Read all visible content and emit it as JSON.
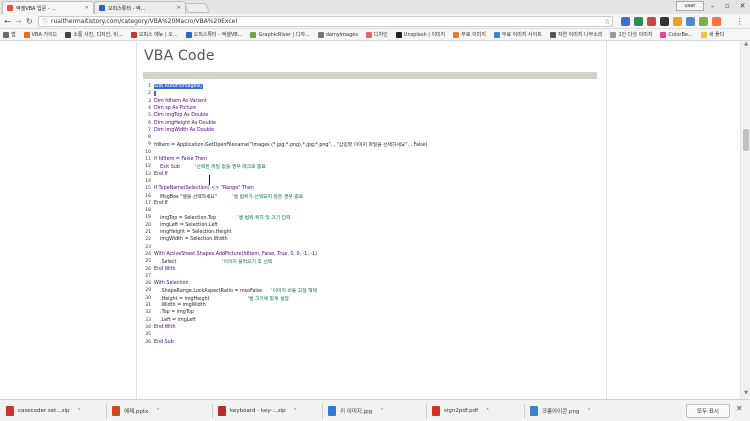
{
  "tabs": [
    {
      "title": "엑셀VBA 입문 - ...",
      "color": "#e8523a",
      "active": true
    },
    {
      "title": "오피스튜터 - 엑...",
      "color": "#2a64c8",
      "active": false
    }
  ],
  "window": {
    "user": "user"
  },
  "toolbar": {
    "url": "rualthermaitistory.com/category/VBA%20Macro/VBA%20Excel",
    "extensions": [
      "#3a6fd8",
      "#2c8f4e",
      "#d04242",
      "#333333",
      "#f0a020",
      "#4f8ad8"
    ]
  },
  "bookmarks": [
    {
      "label": "앱",
      "color": "#6a6a6a"
    },
    {
      "label": "VBA 가이드",
      "color": "#e07020"
    },
    {
      "label": "소통 사진, 디자인, 비...",
      "color": "#444"
    },
    {
      "label": "오피스 메뉴 | 오...",
      "color": "#c43a2a"
    },
    {
      "label": "오피스튜터 - 엑셀VB...",
      "color": "#2a64c8"
    },
    {
      "label": "GraphicRiver | 디자...",
      "color": "#6aa84f"
    },
    {
      "label": "damyimages",
      "color": "#777"
    },
    {
      "label": "디자인",
      "color": "#e06666"
    },
    {
      "label": "Unsplash | 이미지",
      "color": "#222"
    },
    {
      "label": "무료 이미지",
      "color": "#e67e22"
    },
    {
      "label": "무료 이미지 사이트",
      "color": "#3d85c6"
    },
    {
      "label": "자연 이미지 나무소리",
      "color": "#555"
    },
    {
      "label": "1인 다섯 이미지",
      "color": "#999"
    },
    {
      "label": "ColorBe...",
      "color": "#e84393"
    },
    {
      "label": "새 폴더",
      "color": "#f1c232"
    }
  ],
  "page": {
    "heading": "VBA Code"
  },
  "code_lines": [
    {
      "n": "1",
      "segs": [
        {
          "t": "Sub AutoFitImages()",
          "c": "sel"
        }
      ]
    },
    {
      "n": "2",
      "segs": [
        {
          "t": " ",
          "c": "sel"
        }
      ]
    },
    {
      "n": "3",
      "segs": [
        {
          "t": "Dim fdItem As Variant",
          "c": "kw"
        }
      ]
    },
    {
      "n": "4",
      "segs": [
        {
          "t": "Dim sp As Picture",
          "c": "kw"
        }
      ]
    },
    {
      "n": "5",
      "segs": [
        {
          "t": "Dim imgTop As Double",
          "c": "kw"
        }
      ]
    },
    {
      "n": "6",
      "segs": [
        {
          "t": "Dim imgHeight As Double",
          "c": "kw"
        }
      ]
    },
    {
      "n": "7",
      "segs": [
        {
          "t": "Dim imgWidth As Double",
          "c": "kw"
        }
      ]
    },
    {
      "n": "8",
      "segs": []
    },
    {
      "n": "9",
      "segs": [
        {
          "t": "fdItem = Application.GetOpenFilename(\"Images (*.jpg;*.png),*.jpg;*.png\", , \"삽입할 이미지 파일을 선택하세요\", , False)",
          "c": "pl"
        }
      ]
    },
    {
      "n": "10",
      "segs": []
    },
    {
      "n": "11",
      "segs": [
        {
          "t": "If fdItem = False Then",
          "c": "kw"
        }
      ]
    },
    {
      "n": "12",
      "segs": [
        {
          "t": "    Exit Sub          ",
          "c": "kw"
        },
        {
          "t": "'선택된 파일 없을 경우 매크로 종료",
          "c": "cm"
        }
      ]
    },
    {
      "n": "13",
      "segs": [
        {
          "t": "End If",
          "c": "kw"
        }
      ]
    },
    {
      "n": "14",
      "segs": []
    },
    {
      "n": "15",
      "segs": [
        {
          "t": "If TypeName(Selection) <> \"Range\" Then",
          "c": "kw"
        }
      ]
    },
    {
      "n": "16",
      "segs": [
        {
          "t": "    MsgBox \"셀을 선택하세요\"          ",
          "c": "pl"
        },
        {
          "t": "'셀 범위가 선택되지 않은 경우 종료",
          "c": "cm"
        }
      ]
    },
    {
      "n": "17",
      "segs": [
        {
          "t": "End If",
          "c": "kw"
        }
      ]
    },
    {
      "n": "18",
      "segs": []
    },
    {
      "n": "19",
      "segs": [
        {
          "t": "    imgTop = Selection.Top              ",
          "c": "pl"
        },
        {
          "t": "'셀 범위 위치 및 크기 입력",
          "c": "cm"
        }
      ]
    },
    {
      "n": "20",
      "segs": [
        {
          "t": "    imgLeft = Selection.Left",
          "c": "pl"
        }
      ]
    },
    {
      "n": "21",
      "segs": [
        {
          "t": "    imgHeight = Selection.Height",
          "c": "pl"
        }
      ]
    },
    {
      "n": "22",
      "segs": [
        {
          "t": "    imgWidth = Selection.Width",
          "c": "pl"
        }
      ]
    },
    {
      "n": "23",
      "segs": []
    },
    {
      "n": "24",
      "segs": [
        {
          "t": "With ActiveSheet.Shapes.AddPicture(fdItem, False, True, 0, 0, -1, -1)",
          "c": "kw"
        }
      ]
    },
    {
      "n": "25",
      "segs": [
        {
          "t": "    .Select                              ",
          "c": "pl"
        },
        {
          "t": "'이미지 불러오기 후 선택",
          "c": "cm"
        }
      ]
    },
    {
      "n": "26",
      "segs": [
        {
          "t": "End With",
          "c": "kw"
        }
      ]
    },
    {
      "n": "27",
      "segs": []
    },
    {
      "n": "28",
      "segs": [
        {
          "t": "With Selection",
          "c": "kw"
        }
      ]
    },
    {
      "n": "29",
      "segs": [
        {
          "t": "    .ShapeRange.LockAspectRatio = msoFalse      ",
          "c": "pl"
        },
        {
          "t": "'이미지 비율 고정 해제",
          "c": "cm"
        }
      ]
    },
    {
      "n": "30",
      "segs": [
        {
          "t": "    .Height = imgHeight                         ",
          "c": "pl"
        },
        {
          "t": "'셀 크기에 맞게 설정",
          "c": "cm"
        }
      ]
    },
    {
      "n": "31",
      "segs": [
        {
          "t": "    .Width = imgWidth",
          "c": "pl"
        }
      ]
    },
    {
      "n": "32",
      "segs": [
        {
          "t": "    .Top = imgTop",
          "c": "pl"
        }
      ]
    },
    {
      "n": "33",
      "segs": [
        {
          "t": "    .Left = imgLeft",
          "c": "pl"
        }
      ]
    },
    {
      "n": "34",
      "segs": [
        {
          "t": "End With",
          "c": "kw"
        }
      ]
    },
    {
      "n": "35",
      "segs": []
    },
    {
      "n": "36",
      "segs": [
        {
          "t": "End Sub",
          "c": "kw"
        }
      ]
    }
  ],
  "downloads": {
    "items": [
      {
        "name": "casecoder set...zip",
        "color": "#cc3333"
      },
      {
        "name": "예제.pptx",
        "color": "#d24726"
      },
      {
        "name": "keyboard - key-...zip",
        "color": "#b03030"
      },
      {
        "name": "키 이미지.jpg",
        "color": "#2b7bd8"
      },
      {
        "name": "sign2pdf.pdf",
        "color": "#d93025"
      },
      {
        "name": "크롬아이콘.png",
        "color": "#3a7fd0"
      }
    ],
    "show_all": "모두 표시"
  },
  "icons": {
    "back": "arrow-left-icon",
    "forward": "arrow-right-icon",
    "reload": "reload-icon",
    "home": "home-icon",
    "star": "star-icon",
    "menu": "menu-icon"
  }
}
